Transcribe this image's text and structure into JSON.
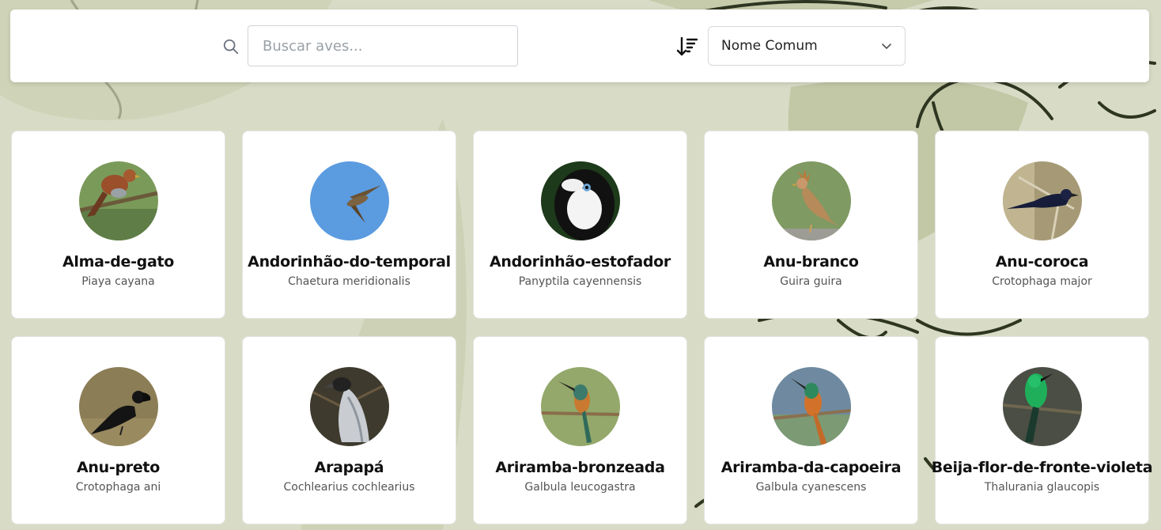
{
  "search": {
    "placeholder": "Buscar aves...",
    "icon": "search-icon"
  },
  "sort": {
    "icon": "sort-descending-icon",
    "selected": "Nome Comum"
  },
  "birds": [
    {
      "common": "Alma-de-gato",
      "scientific": "Piaya cayana"
    },
    {
      "common": "Andorinhão-do-temporal",
      "scientific": "Chaetura meridionalis"
    },
    {
      "common": "Andorinhão-estofador",
      "scientific": "Panyptila cayennensis"
    },
    {
      "common": "Anu-branco",
      "scientific": "Guira guira"
    },
    {
      "common": "Anu-coroca",
      "scientific": "Crotophaga major"
    },
    {
      "common": "Anu-preto",
      "scientific": "Crotophaga ani"
    },
    {
      "common": "Arapapá",
      "scientific": "Cochlearius cochlearius"
    },
    {
      "common": "Ariramba-bronzeada",
      "scientific": "Galbula leucogastra"
    },
    {
      "common": "Ariramba-da-capoeira",
      "scientific": "Galbula cyanescens"
    },
    {
      "common": "Beija-flor-de-fronte-violeta",
      "scientific": "Thalurania glaucopis"
    }
  ],
  "colors": {
    "background": "#d8dcc6",
    "leaf_line": "#2e3521",
    "card": "#ffffff"
  }
}
